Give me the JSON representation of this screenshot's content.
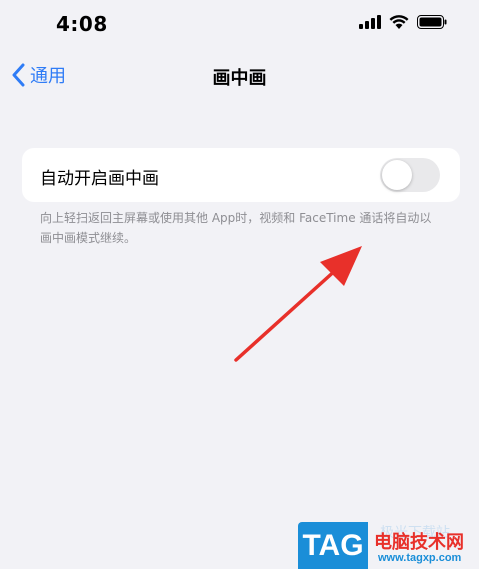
{
  "status_bar": {
    "time": "4:08",
    "icons": [
      "signal-icon",
      "wifi-icon",
      "battery-icon"
    ]
  },
  "nav": {
    "back_label": "通用",
    "title": "画中画",
    "icon": "chevron-left-icon"
  },
  "settings": {
    "rows": [
      {
        "label": "自动开启画中画",
        "toggle_on": false
      }
    ],
    "footer": "向上轻扫返回主屏幕或使用其他 App时，视频和 FaceTime 通话将自动以画中画模式继续。"
  },
  "watermark": {
    "tag": "TAG",
    "site_name": "电脑技术网",
    "url": "www.tagxp.com",
    "background_text": "极光下载站"
  },
  "colors": {
    "accent": "#2f7cf6",
    "background": "#f2f2f6",
    "toggle_off": "#e9e9eb",
    "annotation_arrow": "#e8302a"
  }
}
